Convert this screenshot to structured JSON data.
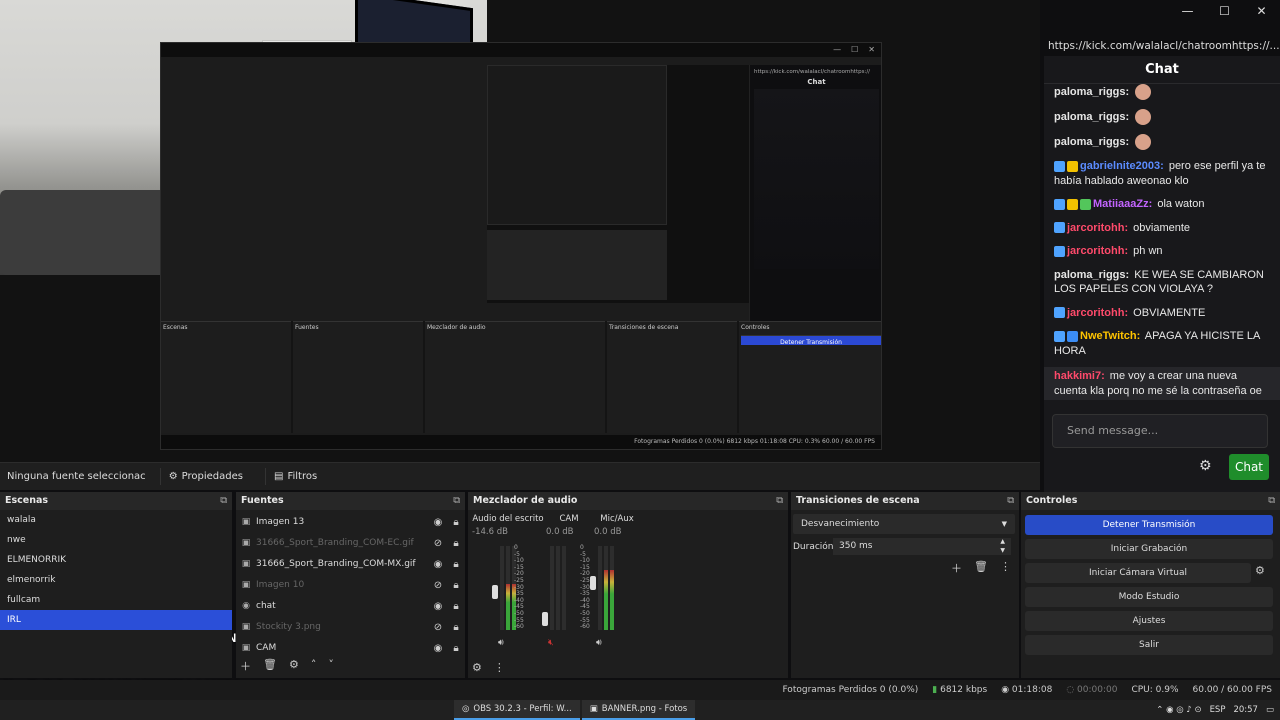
{
  "window_controls": {
    "minimize": "—",
    "maximize": "☐",
    "close": "✕"
  },
  "nested": {
    "chat_title": "Chat",
    "url": "https://kick.com/walalacl/chatroomhttps://",
    "docks": [
      "Escenas",
      "Fuentes",
      "Mezclador de audio",
      "Transiciones de escena",
      "Controles"
    ],
    "blue_btn": "Detener Transmisión",
    "status": "Fotogramas Perdidos 0 (0.0%)   6812 kbps   01:18:08   CPU: 0.3%   60.00 / 60.00 FPS"
  },
  "overlay_chat": [
    {
      "user": "jarcoritohh",
      "text": ": obviamente",
      "color": "#e0245e"
    },
    {
      "user": "jarcoritohh",
      "text": ": ph wn",
      "color": "#e0245e"
    },
    {
      "user": "paloma_riggs",
      "text": ": KE WEA SE CAMBIARON LOS PAPELES CON VIOLAYA ?",
      "color": "#ffffff"
    },
    {
      "user": "jarcoritohh",
      "text": ": OBVIAMENTE",
      "color": "#e0245e"
    },
    {
      "user": "NweTwitch",
      "text": ": APAGA YA HICISTE LA HORA",
      "color": "#f0c000"
    },
    {
      "user": "hakkimi7",
      "text": ": me voy a crear una nueva cuenta kla porq no me sé la contraseña oe",
      "color": "#e0245e"
    }
  ],
  "kick": {
    "url": "https://kick.com/walalacl/chatroomhttps://...",
    "close": "✕",
    "title": "Chat",
    "messages": [
      {
        "user": "paloma_riggs:",
        "text": "",
        "color": "#e6e6e6",
        "emote": true
      },
      {
        "user": "paloma_riggs:",
        "text": "",
        "color": "#e6e6e6",
        "emote": true
      },
      {
        "user": "paloma_riggs:",
        "text": "",
        "color": "#e6e6e6",
        "emote": true
      },
      {
        "user": "gabrielnite2003:",
        "text": " pero ese perfil ya te había hablado aweonao klo",
        "color": "#5b8cff",
        "badges": [
          "#4fa3ff",
          "#f2c100"
        ]
      },
      {
        "user": "MatiiaaaZz:",
        "text": " ola waton",
        "color": "#c264ff",
        "badges": [
          "#4fa3ff",
          "#f2c100",
          "#53c65b"
        ]
      },
      {
        "user": "jarcoritohh:",
        "text": " obviamente",
        "color": "#ff4a6b",
        "badges": [
          "#4fa3ff"
        ]
      },
      {
        "user": "jarcoritohh:",
        "text": " ph wn",
        "color": "#ff4a6b",
        "badges": [
          "#4fa3ff"
        ]
      },
      {
        "user": "paloma_riggs:",
        "text": " KE WEA SE CAMBIARON LOS PAPELES CON VIOLAYA ?",
        "color": "#e6e6e6"
      },
      {
        "user": "jarcoritohh:",
        "text": " OBVIAMENTE",
        "color": "#ff4a6b",
        "badges": [
          "#4fa3ff"
        ]
      },
      {
        "user": "NweTwitch:",
        "text": " APAGA YA HICISTE LA HORA",
        "color": "#ffc400",
        "badges": [
          "#4fa3ff",
          "#3b8cf5"
        ]
      },
      {
        "user": "hakkimi7:",
        "text": " me voy a crear una nueva cuenta kla porq no me sé la contraseña oe",
        "color": "#ff4a6b",
        "highlight": true
      }
    ],
    "send_placeholder": "Send message...",
    "chat_button": "Chat"
  },
  "source_bar": {
    "no_source": "Ninguna fuente seleccionac",
    "properties": "Propiedades",
    "filters": "Filtros"
  },
  "scenes": {
    "title": "Escenas",
    "items": [
      "walala",
      "nwe",
      "ELMENORRIK",
      "elmenorrik",
      "fullcam",
      "IRL"
    ]
  },
  "sources": {
    "title": "Fuentes",
    "items": [
      {
        "name": "Imagen 13",
        "icon": "▣",
        "visible": true
      },
      {
        "name": "31666_Sport_Branding_COM-EC.gif",
        "icon": "▣",
        "visible": false
      },
      {
        "name": "31666_Sport_Branding_COM-MX.gif",
        "icon": "▣",
        "visible": true
      },
      {
        "name": "Imagen 10",
        "icon": "▣",
        "visible": false
      },
      {
        "name": "chat",
        "icon": "◉",
        "visible": true
      },
      {
        "name": "Stockity 3.png",
        "icon": "▣",
        "visible": false
      },
      {
        "name": "CAM",
        "icon": "▣",
        "visible": true
      }
    ]
  },
  "mixer": {
    "title": "Mezclador de audio",
    "channels": [
      {
        "name": "Audio del escrito",
        "db": "-14.6 dB",
        "level": 0.55
      },
      {
        "name": "CAM",
        "db": "0.0 dB",
        "level": 0.0
      },
      {
        "name": "Mic/Aux",
        "db": "0.0 dB",
        "level": 0.72
      }
    ],
    "scale": [
      "0",
      "-5",
      "-10",
      "-15",
      "-20",
      "-25",
      "-30",
      "-35",
      "-40",
      "-45",
      "-50",
      "-55",
      "-60"
    ]
  },
  "transitions": {
    "title": "Transiciones de escena",
    "selected": "Desvanecimiento",
    "duration_label": "Duración",
    "duration_value": "350 ms"
  },
  "controls": {
    "title": "Controles",
    "buttons": [
      "Detener Transmisión",
      "Iniciar Grabación",
      "Iniciar Cámara Virtual",
      "Modo Estudio",
      "Ajustes",
      "Salir"
    ]
  },
  "status": {
    "dropped": "Fotogramas Perdidos 0 (0.0%)",
    "kbps": "6812 kbps",
    "live_time": "01:18:08",
    "rec_time": "00:00:00",
    "cpu": "CPU: 0.9%",
    "fps": "60.00 / 60.00 FPS"
  },
  "taskbar": {
    "items": [
      "OBS 30.2.3 - Perfil: W...",
      "BANNER.png - Fotos"
    ],
    "lang": "ESP",
    "time": "20:57"
  },
  "colors": {
    "accent_blue": "#284cc7",
    "kick_green": "#1f8d2b"
  }
}
